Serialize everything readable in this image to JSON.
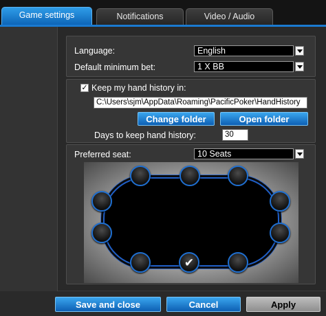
{
  "tabs": [
    {
      "label": "Game settings",
      "active": true
    },
    {
      "label": "Notifications",
      "active": false
    },
    {
      "label": "Video / Audio",
      "active": false
    }
  ],
  "general": {
    "language_label": "Language:",
    "language_value": "English",
    "min_bet_label": "Default minimum bet:",
    "min_bet_value": "1 X BB"
  },
  "history": {
    "keep_checked": true,
    "keep_label": "Keep my hand history in:",
    "path": "C:\\Users\\sjm\\AppData\\Roaming\\PacificPoker\\HandHistory",
    "change_folder_label": "Change folder",
    "open_folder_label": "Open folder",
    "days_label": "Days to keep hand history:",
    "days_value": "30"
  },
  "seat": {
    "preferred_label": "Preferred seat:",
    "preferred_value": "10 Seats",
    "selected_seat_glyph": "✔"
  },
  "footer": {
    "save_close_label": "Save and close",
    "cancel_label": "Cancel",
    "apply_label": "Apply"
  },
  "icons": {
    "dropdown": "chevron-down-icon",
    "checkmark": "checkmark-icon"
  },
  "colors": {
    "accent_blue": "#1a7ad0",
    "seat_ring": "#1f6fd0",
    "apply_gray": "#a8a8a8"
  }
}
